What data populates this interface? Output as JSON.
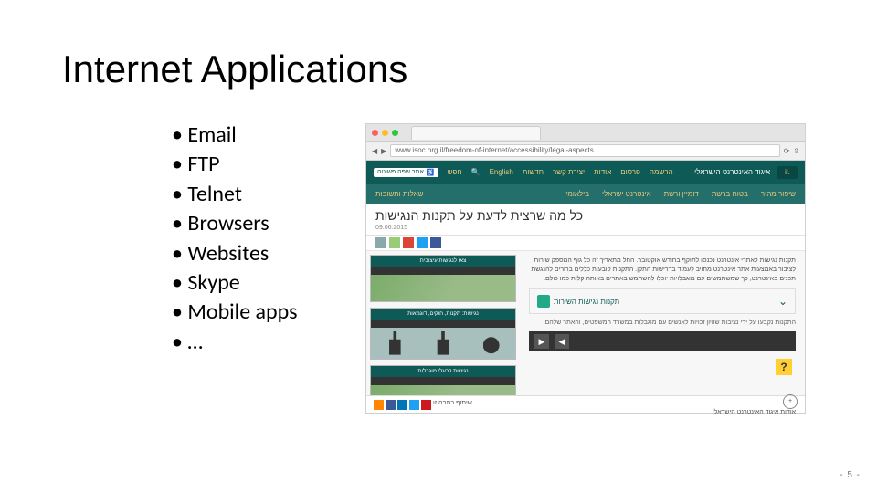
{
  "title": "Internet Applications",
  "bullets": [
    "Email",
    "FTP",
    "Telnet",
    "Browsers",
    "Websites",
    "Skype",
    "Mobile apps",
    "…"
  ],
  "page_number": "- 5 -",
  "screenshot": {
    "url": "www.isoc.org.il/freedom-of-internet/accessibility/legal-aspects",
    "top_nav": {
      "items": [
        "English",
        "חדשות",
        "יצירת קשר",
        "אודות",
        "פרסום",
        "הרשמה"
      ],
      "brand": "איגוד האינטרנט הישראלי",
      "logo": ".il",
      "badge": "אתר שפה פשוטה",
      "search_label": "חפש"
    },
    "sub_nav": [
      "שאלות ותשובות",
      "בילאומי",
      "אינטרנט ישראלי",
      "דומיין ורשת",
      "בטוח ברשת",
      "שיפור מהיר"
    ],
    "hero_title": "כל מה שרצית לדעת על תקנות הנגישות",
    "hero_date": "09.06.2015",
    "cards": [
      "צאו לנגישות עיצובית",
      "נגישות: תקנות, חוקים, דוגמאות",
      "נגישות לבעלי מוגבלות"
    ],
    "paragraph": "תקנות נגישות לאתרי אינטרנט נכנסו לתוקף בחודש אוקטובר. החל מתאריך זה כל גוף המספק שירות לציבור באמצעות אתר אינטרנט מחויב לעמוד בדרישות התקן. התקנות קובעות כללים ברורים להנגשת תכנים באינטרנט, כך שמשתמשים עם מוגבלויות יוכלו להשתמש באתרים באותה קלות כמו כולם.",
    "accordion": "תקנות נגישות השירות",
    "acc_sub": "התקנות נקבעו על ידי נציבות שוויון זכויות לאנשים עם מוגבלות במשרד המשפטים, והאתר שלהם.",
    "footer_about": "אודות איגוד האינטרנט הישראלי",
    "footer_share": "שיתוף כתבה זו"
  }
}
